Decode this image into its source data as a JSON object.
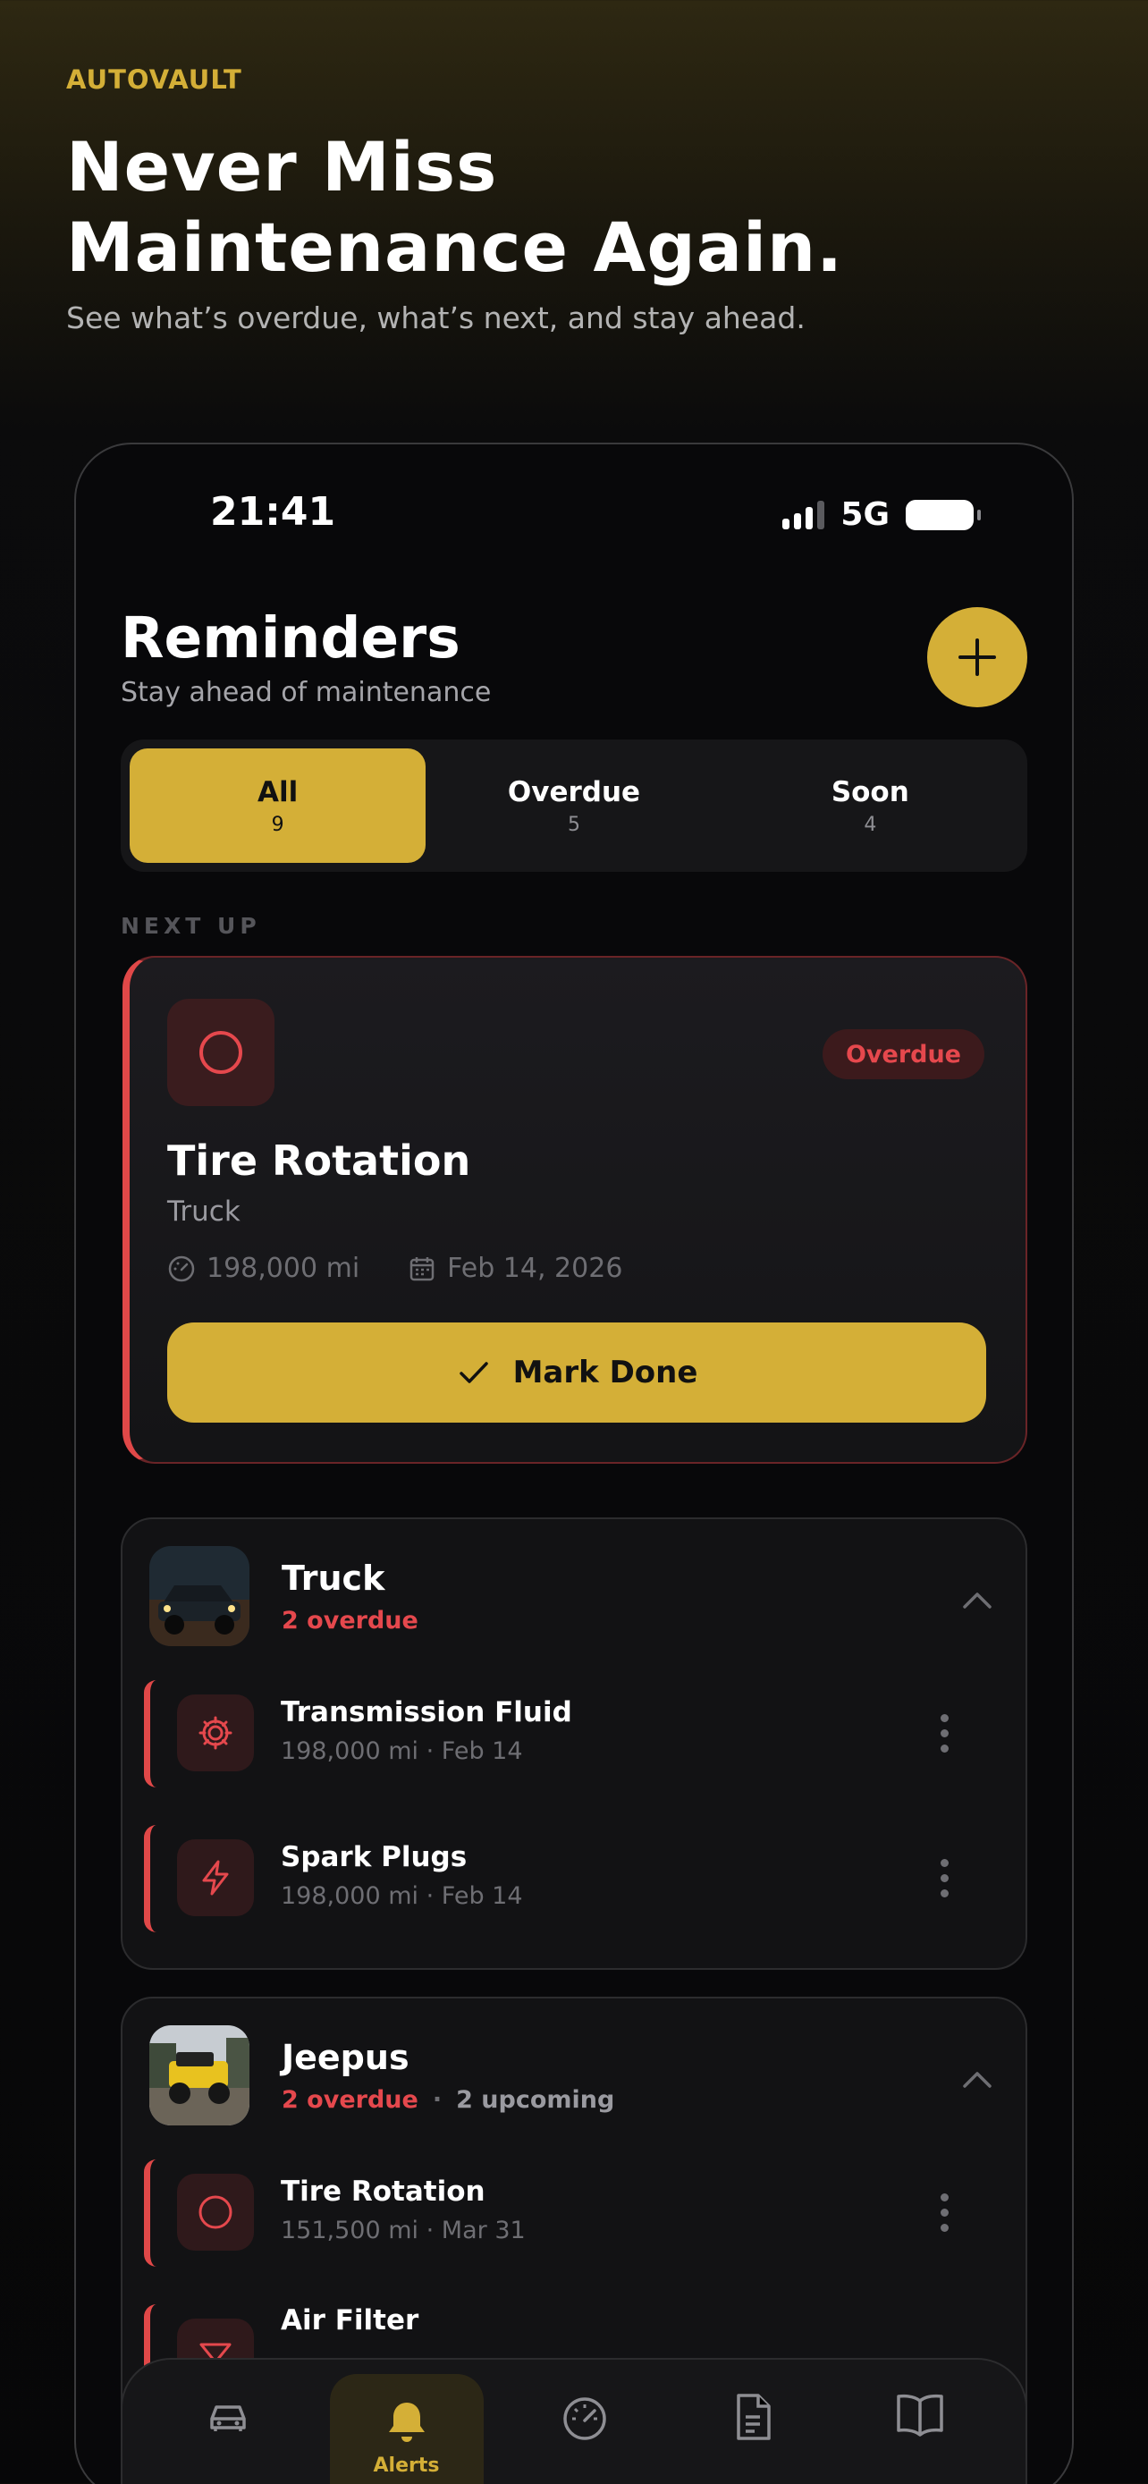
{
  "hero": {
    "brand": "AUTOVAULT",
    "headline_line1": "Never Miss",
    "headline_line2": "Maintenance Again.",
    "subline": "See what’s overdue, what’s next, and stay ahead."
  },
  "status_bar": {
    "time": "21:41",
    "network": "5G"
  },
  "header": {
    "title": "Reminders",
    "subtitle": "Stay ahead of maintenance",
    "add_icon": "plus-icon"
  },
  "filters": [
    {
      "label": "All",
      "count": "9",
      "active": true
    },
    {
      "label": "Overdue",
      "count": "5",
      "active": false
    },
    {
      "label": "Soon",
      "count": "4",
      "active": false
    }
  ],
  "next_up": {
    "section_label": "NEXT UP",
    "badge": "Overdue",
    "title": "Tire Rotation",
    "vehicle": "Truck",
    "mileage": "198,000 mi",
    "date": "Feb 14, 2026",
    "button": "Mark Done"
  },
  "groups": [
    {
      "name": "Truck",
      "overdue": "2 overdue",
      "items": [
        {
          "title": "Transmission Fluid",
          "mileage": "198,000 mi",
          "date": "Feb 14",
          "icon": "gear-icon"
        },
        {
          "title": "Spark Plugs",
          "mileage": "198,000 mi",
          "date": "Feb 14",
          "icon": "lightning-icon"
        }
      ]
    },
    {
      "name": "Jeepus",
      "overdue": "2 overdue",
      "upcoming": "2 upcoming",
      "items": [
        {
          "title": "Tire Rotation",
          "mileage": "151,500 mi",
          "date": "Mar 31",
          "icon": "circle-icon"
        },
        {
          "title": "Air Filter",
          "icon": "filter-icon"
        }
      ]
    }
  ],
  "tabbar": {
    "active_label": "Alerts",
    "tabs": [
      "car-icon",
      "bell-icon",
      "gauge-icon",
      "document-icon",
      "book-icon"
    ]
  },
  "colors": {
    "accent": "#d4af37",
    "danger": "#e5484d",
    "background": "#08080a"
  }
}
